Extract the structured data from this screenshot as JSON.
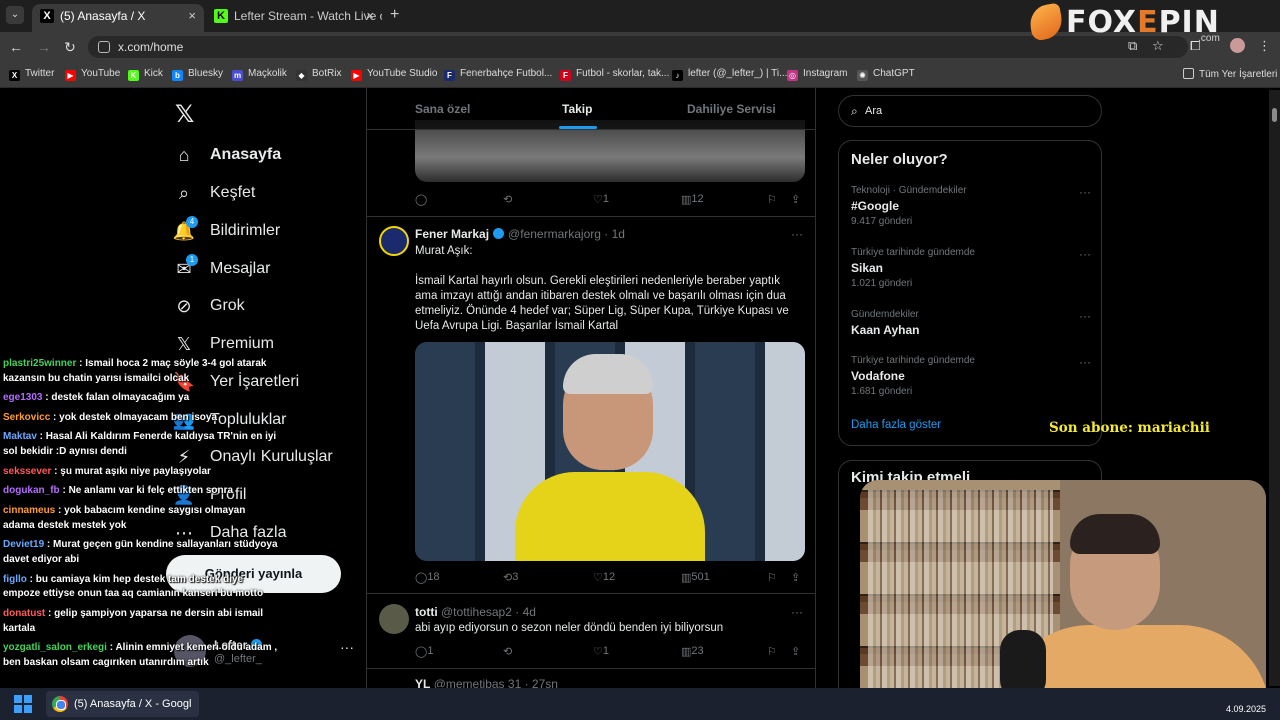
{
  "browser": {
    "tabs": [
      {
        "title": "(5) Anasayfa / X",
        "icon": "x-favicon",
        "active": true
      },
      {
        "title": "Lefter Stream - Watch Live on K",
        "icon": "kick-favicon",
        "active": false
      }
    ],
    "new_tab": "+",
    "close_glyph": "×",
    "url": "x.com/home"
  },
  "overlay_logo": {
    "prefix": "FOX",
    "accent": "E",
    "suffix": "PIN",
    "sub": ".com"
  },
  "bookmarks": [
    {
      "label": "Twitter",
      "icon": "x-icon",
      "color": "#000000",
      "glyph": "X"
    },
    {
      "label": "YouTube",
      "icon": "youtube-icon",
      "color": "#ff0000",
      "glyph": "▶"
    },
    {
      "label": "Kick",
      "icon": "kick-icon",
      "color": "#53fc18",
      "glyph": "K"
    },
    {
      "label": "Bluesky",
      "icon": "bluesky-icon",
      "color": "#1185fe",
      "glyph": "b"
    },
    {
      "label": "Maçkolik",
      "icon": "mackolik-icon",
      "color": "#4a4fd1",
      "glyph": "m"
    },
    {
      "label": "BotRix",
      "icon": "botrix-icon",
      "color": "#333333",
      "glyph": "◆"
    },
    {
      "label": "YouTube Studio",
      "icon": "youtube-studio-icon",
      "color": "#ff0000",
      "glyph": "▶"
    },
    {
      "label": "Fenerbahçe Futbol...",
      "icon": "fenerbahce-icon",
      "color": "#1a2a6c",
      "glyph": "F"
    },
    {
      "label": "Futbol - skorlar, tak...",
      "icon": "flashscore-icon",
      "color": "#d0021b",
      "glyph": "F"
    },
    {
      "label": "lefter (@_lefter_) | Ti...",
      "icon": "tiktok-icon",
      "color": "#000000",
      "glyph": "♪"
    },
    {
      "label": "Instagram",
      "icon": "instagram-icon",
      "color": "#c13584",
      "glyph": "◎"
    },
    {
      "label": "ChatGPT",
      "icon": "chatgpt-icon",
      "color": "#555555",
      "glyph": "✺"
    }
  ],
  "bookmarks_all": "Tüm Yer İşaretleri",
  "nav": [
    {
      "label": "Anasayfa",
      "icon": "home-icon",
      "glyph": "⌂",
      "bold": true
    },
    {
      "label": "Keşfet",
      "icon": "search-icon",
      "glyph": "⌕"
    },
    {
      "label": "Bildirimler",
      "icon": "bell-icon",
      "glyph": "🔔",
      "badge": "4"
    },
    {
      "label": "Mesajlar",
      "icon": "mail-icon",
      "glyph": "✉",
      "badge": "1"
    },
    {
      "label": "Grok",
      "icon": "grok-icon",
      "glyph": "⊘"
    },
    {
      "label": "Premium",
      "icon": "premium-x-icon",
      "glyph": "𝕏"
    },
    {
      "label": "Yer İşaretleri",
      "icon": "bookmark-icon",
      "glyph": "🔖"
    },
    {
      "label": "Topluluklar",
      "icon": "communities-icon",
      "glyph": "👥"
    },
    {
      "label": "Onaylı Kuruluşlar",
      "icon": "lightning-icon",
      "glyph": "⚡"
    },
    {
      "label": "Profil",
      "icon": "profile-icon",
      "glyph": "👤"
    },
    {
      "label": "Daha fazla",
      "icon": "more-circle-icon",
      "glyph": "⋯"
    }
  ],
  "post_button": "Gönderi yayınla",
  "profile": {
    "name": "Lefter",
    "handle": "@_lefter_",
    "more": "···"
  },
  "feed_tabs": [
    {
      "label": "Sana özel",
      "active": false
    },
    {
      "label": "Takip",
      "active": true
    },
    {
      "label": "Dahiliye Servisi",
      "active": false
    }
  ],
  "tweets": [
    {
      "counts": {
        "replies": "",
        "reposts": "",
        "likes": "1",
        "views": "12"
      }
    },
    {
      "author": "Fener Markaj",
      "handle": "@fenermarkajorg",
      "time": "1d",
      "text_title": "Murat Aşık:",
      "text_body": "İsmail Kartal hayırlı olsun. Gerekli eleştirileri nedenleriyle beraber yaptık ama imzayı attığı andan itibaren destek olmalı ve başarılı olması için dua etmeliyiz. Önünde 4 hedef var; Süper Lig, Süper Kupa, Türkiye Kupası ve Uefa Avrupa Ligi. Başarılar İsmail Kartal",
      "counts": {
        "replies": "18",
        "reposts": "3",
        "likes": "12",
        "views": "501"
      }
    },
    {
      "author": "totti",
      "handle": "@tottihesap2",
      "time": "4d",
      "text": "abi ayıp ediyorsun o sezon neler döndü benden iyi biliyorsun",
      "counts": {
        "replies": "1",
        "reposts": "",
        "likes": "1",
        "views": "23"
      }
    },
    {
      "author": "YL",
      "handle": "@memetibas 31",
      "time": "27sn"
    }
  ],
  "search": {
    "placeholder": "Ara"
  },
  "trends": {
    "title": "Neler oluyor?",
    "items": [
      {
        "context": "Teknoloji · Gündemdekiler",
        "name": "#Google",
        "count": "9.417 gönderi"
      },
      {
        "context": "Türkiye tarihinde gündemde",
        "name": "Sikan",
        "count": "1.021 gönderi"
      },
      {
        "context": "Gündemdekiler",
        "name": "Kaan Ayhan",
        "count": ""
      },
      {
        "context": "Türkiye tarihinde gündemde",
        "name": "Vodafone",
        "count": "1.681 gönderi"
      }
    ],
    "show_more": "Daha fazla göster"
  },
  "who_to_follow": {
    "title": "Kimi takip etmeli"
  },
  "stream_overlay": {
    "last_sub": "Son abone: mariachii",
    "chat": [
      {
        "user": "plastri25winner",
        "color": "#45d35a",
        "msg": "Ismail hoca 2 maç söyle 3-4 gol atarak kazansın bu chatin yarısı ismailci olcak"
      },
      {
        "user": "ege1303",
        "color": "#b46bff",
        "msg": "destek falan olmayacağım ya"
      },
      {
        "user": "Serkovicc",
        "color": "#ff9d2e",
        "msg": "yok destek olmayacam ben isoya"
      },
      {
        "user": "Maktav",
        "color": "#6aa8ff",
        "msg": "Hasal Ali Kaldırım Fenerde kaldıysa TR'nin en iyi sol bekidir :D aynısı dendi"
      },
      {
        "user": "sekssever",
        "color": "#ff5a5a",
        "msg": "şu murat aşıkı niye paylaşıyolar"
      },
      {
        "user": "dogukan_fb",
        "color": "#b46bff",
        "msg": "Ne anlamı var ki felç ettikten sonra"
      },
      {
        "user": "cinnameus",
        "color": "#ff9d2e",
        "msg": "yok babacım kendine saygısı olmayan adama destek mestek yok"
      },
      {
        "user": "Deviet19",
        "color": "#6aa8ff",
        "msg": "Murat geçen gün kendine sallayanları stüdyoya davet ediyor abi"
      },
      {
        "user": "figllo",
        "color": "#6aa8ff",
        "msg": "bu camiaya kim hep destek tam destek diye empoze ettiyse onun taa aq camianın kanseri bu motto"
      },
      {
        "user": "donatust",
        "color": "#ff5a5a",
        "msg": "gelip şampiyon yaparsa ne dersin abi ismail kartala"
      },
      {
        "user": "yozgatli_salon_erkegi",
        "color": "#45d35a",
        "msg": "Alinin emniyet kemeri oldu adam , ben baskan olsam cagırıken utanırdım artık"
      }
    ]
  },
  "taskbar": {
    "app_label": "(5) Anasayfa / X - Googl",
    "date": "4.09.2025"
  },
  "colors": {
    "accent": "#1d9bf0",
    "sub_text": "#f4ea2f"
  }
}
